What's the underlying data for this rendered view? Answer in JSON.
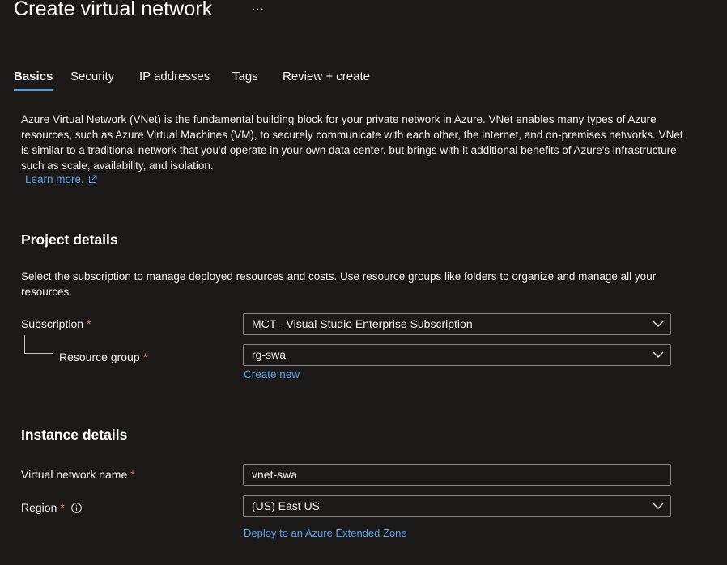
{
  "header": {
    "title": "Create virtual network",
    "more_label": "···"
  },
  "tabs": [
    {
      "label": "Basics",
      "active": true
    },
    {
      "label": "Security",
      "active": false
    },
    {
      "label": "IP addresses",
      "active": false
    },
    {
      "label": "Tags",
      "active": false
    },
    {
      "label": "Review + create",
      "active": false
    }
  ],
  "intro": {
    "text": "Azure Virtual Network (VNet) is the fundamental building block for your private network in Azure. VNet enables many types of Azure resources, such as Azure Virtual Machines (VM), to securely communicate with each other, the internet, and on-premises networks. VNet is similar to a traditional network that you'd operate in your own data center, but brings with it additional benefits of Azure's infrastructure such as scale, availability, and isolation.",
    "learn_more": "Learn more."
  },
  "project": {
    "heading": "Project details",
    "description": "Select the subscription to manage deployed resources and costs. Use resource groups like folders to organize and manage all your resources.",
    "subscription_label": "Subscription",
    "subscription_value": "MCT - Visual Studio Enterprise Subscription",
    "resource_group_label": "Resource group",
    "resource_group_value": "rg-swa",
    "create_new": "Create new"
  },
  "instance": {
    "heading": "Instance details",
    "vnet_name_label": "Virtual network name",
    "vnet_name_value": "vnet-swa",
    "region_label": "Region",
    "region_value": "(US) East US",
    "extended_zone_link": "Deploy to an Azure Extended Zone"
  },
  "required_marker": "*",
  "colors": {
    "background": "#1b1a19",
    "accent": "#4f9fe0",
    "link": "#5ea2ea",
    "required": "#f1707b"
  }
}
